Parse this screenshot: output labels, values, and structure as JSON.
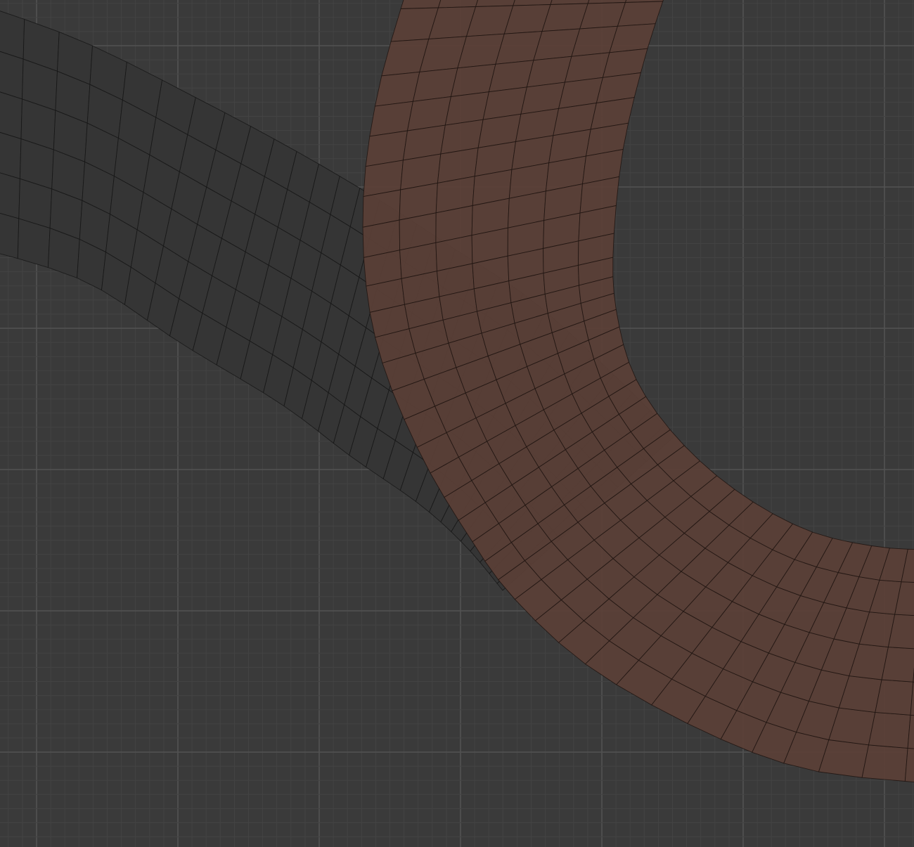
{
  "viewport": {
    "background_color": "#3a3a3a",
    "minor_grid_color": "#434343",
    "major_grid_color": "#525252"
  },
  "meshes": [
    {
      "name": "unselected-curve-mesh",
      "state": "unselected",
      "face_color": "#353535",
      "edge_color": "#161616"
    },
    {
      "name": "selected-curve-mesh",
      "state": "selected",
      "face_color": "#5a4037",
      "edge_color": "#1e1410"
    }
  ]
}
